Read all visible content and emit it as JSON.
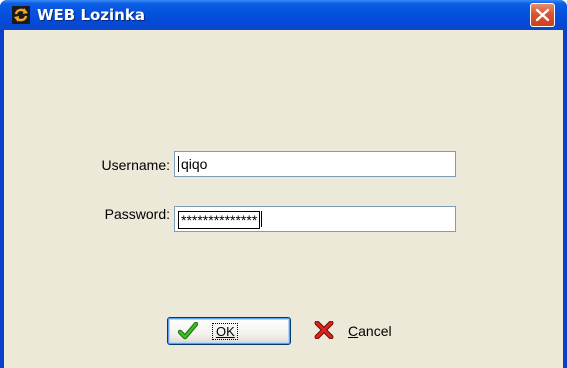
{
  "window": {
    "title": "WEB Lozinka"
  },
  "form": {
    "username_label": "Username:",
    "username_value": "qiqo",
    "password_label": "Password:",
    "password_value": "**************"
  },
  "buttons": {
    "ok_label": "OK",
    "cancel_label_first": "C",
    "cancel_label_rest": "ancel"
  },
  "icons": {
    "app": "refresh-arrows-icon",
    "close": "close-x-icon",
    "ok": "green-checkmark-icon",
    "cancel": "red-x-icon"
  },
  "colors": {
    "titlebar": "#0553e0",
    "client_bg": "#ece9d8",
    "close_button": "#d9552f",
    "ok_icon": "#2f9e1c",
    "cancel_icon": "#c8140f"
  }
}
